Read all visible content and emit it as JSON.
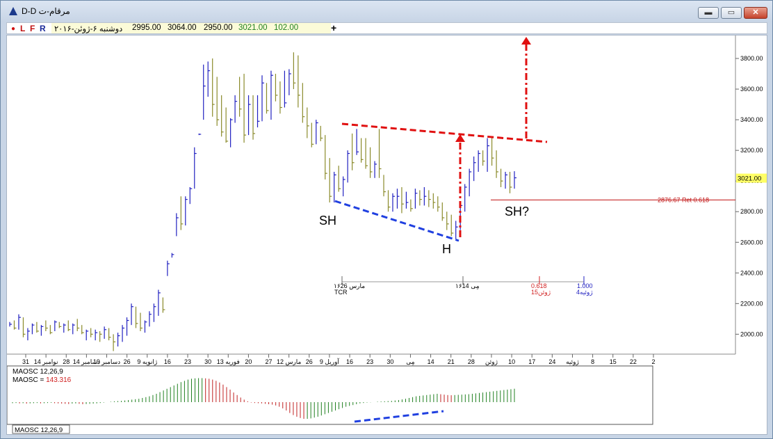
{
  "window": {
    "title": "D-D مرقام-ت",
    "buttons": [
      {
        "name": "minimize",
        "glyph": "▬"
      },
      {
        "name": "maximize",
        "glyph": "▭"
      },
      {
        "name": "close",
        "glyph": "✕"
      }
    ]
  },
  "toolbar": {
    "buttons": [
      "L",
      "F",
      "R"
    ],
    "date": "دوشنبه ۶-ژوئن-۲۰۱۶",
    "open": "2995.00",
    "high": "3064.00",
    "low": "2950.00",
    "close": "3021.00",
    "change": "102.00",
    "add": "+"
  },
  "colors": {
    "up_bar": "#2020c0",
    "down_bar": "#8a8a2a",
    "red_annot": "#e01010",
    "blue_annot": "#2040e0",
    "price_tag_bg": "#ffff66",
    "osc_up": "#208020",
    "osc_down": "#c02020"
  },
  "chart_data": [
    {
      "type": "bar",
      "y_axis": {
        "ticks": [
          "3800.00",
          "3600.00",
          "3400.00",
          "3200.00",
          "3000.00",
          "2800.00",
          "2600.00",
          "2400.00",
          "2200.00",
          "2000.00"
        ],
        "tick_values": [
          3800,
          3600,
          3400,
          3200,
          3000,
          2800,
          2600,
          2400,
          2200,
          2000
        ],
        "ylim": [
          1870,
          3950
        ]
      },
      "last_price_label": "3021.00",
      "last_price": 3021,
      "retracement": {
        "label": "2876.67 Ret 0.618",
        "value": 2876.67
      },
      "x_axis": {
        "ticks": [
          "31",
          "14 نوامبر",
          "28",
          "14 دسامبر",
          "19 دسامبر",
          "26",
          "9 ژانویه",
          "16",
          "23",
          "30",
          "13 فوریه",
          "20",
          "27",
          "12 مارس",
          "26",
          "9 آوریل",
          "16",
          "23",
          "30",
          "مِی",
          "14",
          "21",
          "28",
          "ژوئن",
          "10",
          "17",
          "24",
          "ژوئیه",
          "8",
          "15",
          "22",
          "2"
        ]
      },
      "annotations": {
        "sh_left": "SH",
        "h": "H",
        "sh_right": "SH?"
      },
      "time_cycle": {
        "left_label_top": "۱۶مارس 26",
        "left_label_bottom": "TCR",
        "mid_label": "۱۶مِی 14",
        "ratio_618": "0.618",
        "ratio_618_date": "15ژوئن",
        "ratio_100": "1.000",
        "ratio_100_date": "4ژوئیه"
      },
      "series": {
        "bars": [
          [
            2050,
            2080,
            2065
          ],
          [
            2030,
            2090,
            2040
          ],
          [
            2030,
            2130,
            2110
          ],
          [
            1980,
            2110,
            2000
          ],
          [
            1960,
            2040,
            2020
          ],
          [
            2000,
            2070,
            2060
          ],
          [
            2010,
            2080,
            2020
          ],
          [
            1990,
            2060,
            2050
          ],
          [
            2020,
            2090,
            2040
          ],
          [
            2000,
            2060,
            2010
          ],
          [
            2020,
            2090,
            2080
          ],
          [
            2040,
            2080,
            2050
          ],
          [
            2010,
            2070,
            2060
          ],
          [
            2020,
            2090,
            2030
          ],
          [
            2000,
            2070,
            2060
          ],
          [
            2020,
            2100,
            2040
          ],
          [
            2000,
            2060,
            2010
          ],
          [
            1960,
            2030,
            2020
          ],
          [
            1980,
            2040,
            2000
          ],
          [
            1960,
            2030,
            2010
          ],
          [
            1950,
            2020,
            2000
          ],
          [
            1970,
            2050,
            2030
          ],
          [
            1960,
            2040,
            1980
          ],
          [
            1890,
            2000,
            1950
          ],
          [
            1920,
            2010,
            1990
          ],
          [
            1950,
            2060,
            2040
          ],
          [
            1990,
            2110,
            2090
          ],
          [
            2060,
            2200,
            2180
          ],
          [
            2040,
            2180,
            2070
          ],
          [
            2020,
            2140,
            2040
          ],
          [
            2010,
            2090,
            2080
          ],
          [
            2050,
            2150,
            2130
          ],
          [
            2080,
            2200,
            2180
          ],
          [
            2120,
            2290,
            2270
          ],
          [
            2140,
            2240,
            2160
          ],
          [
            2380,
            2480,
            2460
          ],
          [
            2500,
            2530,
            2520
          ],
          [
            2640,
            2790,
            2760
          ],
          [
            2680,
            2900,
            2720
          ],
          [
            2710,
            2900,
            2880
          ],
          [
            2850,
            2960,
            2950
          ],
          [
            2950,
            3220,
            3180
          ],
          [
            3300,
            3310,
            3305
          ],
          [
            3400,
            3760,
            3620
          ],
          [
            3550,
            3780,
            3720
          ],
          [
            3420,
            3800,
            3500
          ],
          [
            3360,
            3680,
            3400
          ],
          [
            3290,
            3560,
            3320
          ],
          [
            3250,
            3480,
            3260
          ],
          [
            3220,
            3410,
            3400
          ],
          [
            3380,
            3560,
            3520
          ],
          [
            3420,
            3680,
            3470
          ],
          [
            3250,
            3700,
            3300
          ],
          [
            3300,
            3560,
            3500
          ],
          [
            3270,
            3560,
            3310
          ],
          [
            3350,
            3560,
            3390
          ],
          [
            3390,
            3690,
            3640
          ],
          [
            3440,
            3640,
            3460
          ],
          [
            3400,
            3720,
            3690
          ],
          [
            3520,
            3700,
            3560
          ],
          [
            3440,
            3650,
            3480
          ],
          [
            3480,
            3720,
            3510
          ],
          [
            3560,
            3730,
            3700
          ],
          [
            3600,
            3840,
            3640
          ],
          [
            3480,
            3820,
            3560
          ],
          [
            3380,
            3640,
            3420
          ],
          [
            3280,
            3480,
            3360
          ],
          [
            3220,
            3380,
            3240
          ],
          [
            3240,
            3400,
            3380
          ],
          [
            3260,
            3360,
            3280
          ],
          [
            3010,
            3300,
            3050
          ],
          [
            2860,
            3150,
            2900
          ],
          [
            2860,
            3060,
            3040
          ],
          [
            2930,
            3100,
            2950
          ],
          [
            2900,
            3030,
            3010
          ],
          [
            2990,
            3200,
            3180
          ],
          [
            3070,
            3310,
            3120
          ],
          [
            3170,
            3340,
            3190
          ],
          [
            3120,
            3280,
            3140
          ],
          [
            3080,
            3280,
            3100
          ],
          [
            3020,
            3220,
            3060
          ],
          [
            3020,
            3130,
            3110
          ],
          [
            3020,
            3340,
            3080
          ],
          [
            2900,
            3040,
            2930
          ],
          [
            2800,
            2940,
            2830
          ],
          [
            2800,
            2920,
            2900
          ],
          [
            2820,
            2950,
            2900
          ],
          [
            2790,
            2960,
            2850
          ],
          [
            2820,
            2930,
            2860
          ],
          [
            2800,
            2880,
            2820
          ],
          [
            2820,
            2950,
            2920
          ],
          [
            2840,
            2940,
            2880
          ],
          [
            2840,
            2960,
            2900
          ],
          [
            2830,
            2940,
            2880
          ],
          [
            2820,
            2920,
            2860
          ],
          [
            2800,
            2900,
            2830
          ],
          [
            2740,
            2860,
            2760
          ],
          [
            2680,
            2800,
            2720
          ],
          [
            2640,
            2780,
            2660
          ],
          [
            2620,
            2740,
            2700
          ],
          [
            2680,
            2860,
            2840
          ],
          [
            2800,
            2980,
            2960
          ],
          [
            2900,
            3080,
            3060
          ],
          [
            3000,
            3160,
            3120
          ],
          [
            3060,
            3200,
            3180
          ],
          [
            3100,
            3200,
            3130
          ],
          [
            3060,
            3280,
            3230
          ],
          [
            3100,
            3290,
            3150
          ],
          [
            3020,
            3200,
            3060
          ],
          [
            2960,
            3080,
            3000
          ],
          [
            2950,
            3060,
            3040
          ],
          [
            2920,
            3060,
            2960
          ],
          [
            2950,
            3064,
            3021
          ]
        ]
      }
    },
    {
      "type": "bar",
      "title_line1": "MAOSC 12,26,9",
      "title_line2_label": "MAOSC = ",
      "title_line2_value": "143.316",
      "tab_label": "MAOSC 12,26,9",
      "values": [
        -5,
        -4,
        -6,
        -5,
        -7,
        -6,
        -5,
        -4,
        -6,
        -5,
        -4,
        -3,
        -5,
        -6,
        -7,
        -8,
        -9,
        -7,
        -6,
        -8,
        -10,
        -9,
        -8,
        -7,
        -6,
        -4,
        -2,
        0,
        2,
        4,
        5,
        6,
        8,
        10,
        12,
        14,
        16,
        20,
        24,
        28,
        34,
        40,
        48,
        56,
        64,
        72,
        80,
        88,
        96,
        102,
        108,
        112,
        114,
        115,
        115,
        114,
        112,
        108,
        102,
        94,
        84,
        72,
        60,
        46,
        34,
        22,
        12,
        4,
        -2,
        -4,
        -5,
        -6,
        -8,
        -10,
        -12,
        -16,
        -22,
        -30,
        -40,
        -52,
        -62,
        -70,
        -76,
        -80,
        -80,
        -78,
        -74,
        -70,
        -64,
        -58,
        -52,
        -46,
        -40,
        -34,
        -28,
        -22,
        -18,
        -14,
        -10,
        -6,
        -4,
        -2,
        -1,
        0,
        2,
        3,
        4,
        5,
        6,
        8,
        10,
        13,
        16,
        20,
        24,
        28,
        30,
        32,
        34,
        36,
        38,
        40,
        38,
        36,
        34,
        33,
        34,
        35,
        36,
        37,
        38,
        40,
        42,
        44,
        46,
        48,
        50,
        52,
        54,
        56,
        58,
        60,
        62,
        64
      ]
    }
  ]
}
